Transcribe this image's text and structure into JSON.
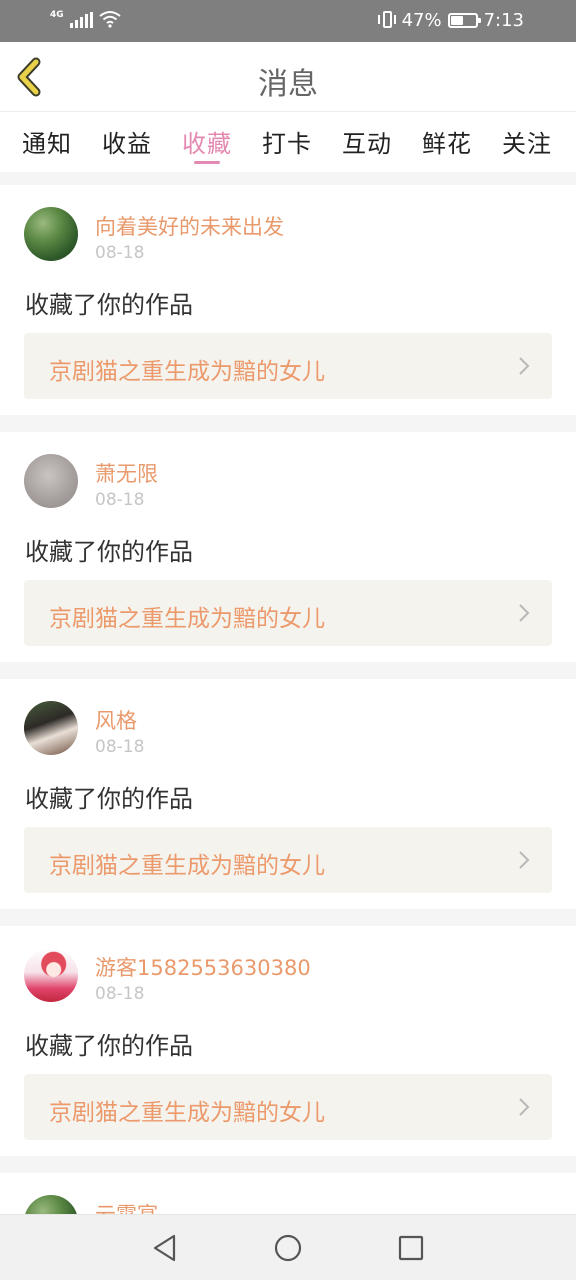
{
  "status_bar": {
    "network": "4G",
    "battery_percent": "47%",
    "battery_level": 0.47,
    "time": "7:13",
    "icons": [
      "signal-icon",
      "wifi-icon",
      "vibrate-icon",
      "battery-icon"
    ]
  },
  "header": {
    "title": "消息",
    "back_icon": "chevron-left-icon",
    "accent_color": "#e8d24a"
  },
  "tabs": [
    {
      "label": "通知",
      "active": false
    },
    {
      "label": "收益",
      "active": false
    },
    {
      "label": "收藏",
      "active": true
    },
    {
      "label": "打卡",
      "active": false
    },
    {
      "label": "互动",
      "active": false
    },
    {
      "label": "鲜花",
      "active": false
    },
    {
      "label": "关注",
      "active": false
    }
  ],
  "colors": {
    "active_tab": "#e48ab2",
    "username": "#e99a6c",
    "work_title": "#ec9a6c",
    "date": "#c6c6c6"
  },
  "notifications": [
    {
      "username": "向着美好的未来出发",
      "date": "08-18",
      "action": "收藏了你的作品",
      "work_title": "京剧猫之重生成为黯的女儿"
    },
    {
      "username": "萧无限",
      "date": "08-18",
      "action": "收藏了你的作品",
      "work_title": "京剧猫之重生成为黯的女儿"
    },
    {
      "username": "风格",
      "date": "08-18",
      "action": "收藏了你的作品",
      "work_title": "京剧猫之重生成为黯的女儿"
    },
    {
      "username": "游客1582553630380",
      "date": "08-18",
      "action": "收藏了你的作品",
      "work_title": "京剧猫之重生成为黯的女儿"
    },
    {
      "username": "云霄宴",
      "partial": true
    }
  ],
  "nav_bar": {
    "buttons": [
      "back-triangle-icon",
      "home-circle-icon",
      "recent-square-icon"
    ]
  }
}
